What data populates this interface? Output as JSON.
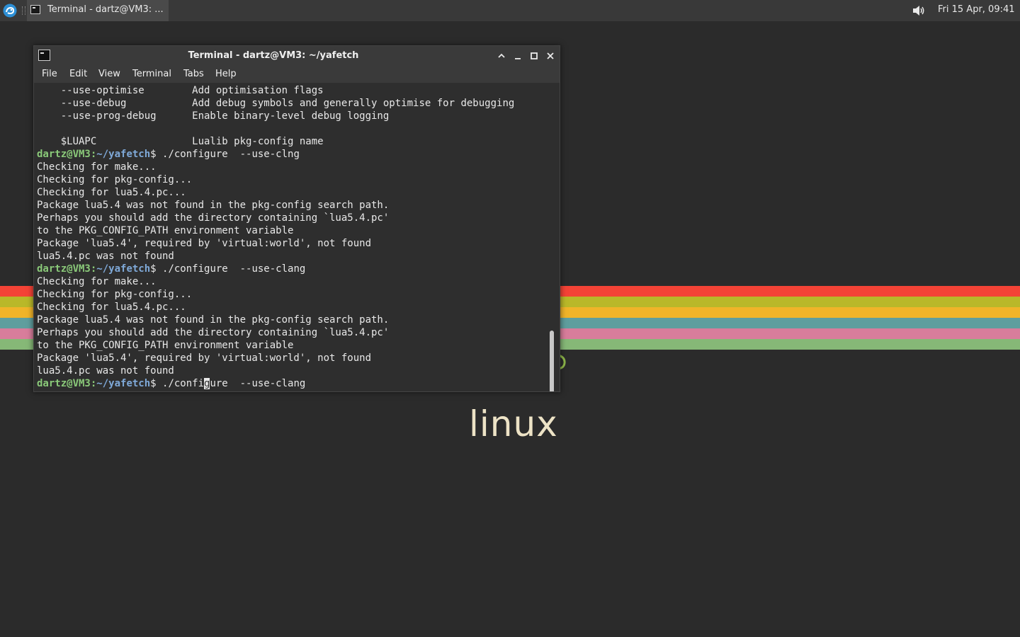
{
  "panel": {
    "task_label": "Terminal - dartz@VM3: ...",
    "clock": "Fri 15 Apr, 09:41",
    "icons": [
      "whisker-menu-icon",
      "terminal-icon",
      "volume-icon"
    ]
  },
  "wallpaper": {
    "text": "linux",
    "stripe_colors": [
      "#f44336",
      "#b9b829",
      "#f0b429",
      "#5f9e9e",
      "#d87d9b",
      "#86b877"
    ]
  },
  "window": {
    "title": "Terminal - dartz@VM3: ~/yafetch",
    "menu": [
      "File",
      "Edit",
      "View",
      "Terminal",
      "Tabs",
      "Help"
    ]
  },
  "terminal": {
    "prompt_user": "dartz@VM3",
    "prompt_path": "~/yafetch",
    "lines": [
      {
        "type": "text",
        "text": "    --use-optimise        Add optimisation flags"
      },
      {
        "type": "text",
        "text": "    --use-debug           Add debug symbols and generally optimise for debugging"
      },
      {
        "type": "text",
        "text": "    --use-prog-debug      Enable binary-level debug logging"
      },
      {
        "type": "text",
        "text": ""
      },
      {
        "type": "text",
        "text": "    $LUAPC                Lualib pkg-config name"
      },
      {
        "type": "prompt",
        "text": "$ ./configure  --use-clng"
      },
      {
        "type": "text",
        "text": "Checking for make..."
      },
      {
        "type": "text",
        "text": "Checking for pkg-config..."
      },
      {
        "type": "text",
        "text": "Checking for lua5.4.pc..."
      },
      {
        "type": "text",
        "text": "Package lua5.4 was not found in the pkg-config search path."
      },
      {
        "type": "text",
        "text": "Perhaps you should add the directory containing `lua5.4.pc'"
      },
      {
        "type": "text",
        "text": "to the PKG_CONFIG_PATH environment variable"
      },
      {
        "type": "text",
        "text": "Package 'lua5.4', required by 'virtual:world', not found"
      },
      {
        "type": "text",
        "text": "lua5.4.pc was not found"
      },
      {
        "type": "prompt",
        "text": "$ ./configure  --use-clang"
      },
      {
        "type": "text",
        "text": "Checking for make..."
      },
      {
        "type": "text",
        "text": "Checking for pkg-config..."
      },
      {
        "type": "text",
        "text": "Checking for lua5.4.pc..."
      },
      {
        "type": "text",
        "text": "Package lua5.4 was not found in the pkg-config search path."
      },
      {
        "type": "text",
        "text": "Perhaps you should add the directory containing `lua5.4.pc'"
      },
      {
        "type": "text",
        "text": "to the PKG_CONFIG_PATH environment variable"
      },
      {
        "type": "text",
        "text": "Package 'lua5.4', required by 'virtual:world', not found"
      },
      {
        "type": "text",
        "text": "lua5.4.pc was not found"
      }
    ],
    "current_input": {
      "before_cursor": "$ ./confi",
      "cursor_char": "g",
      "after_cursor": "ure  --use-clang"
    }
  }
}
